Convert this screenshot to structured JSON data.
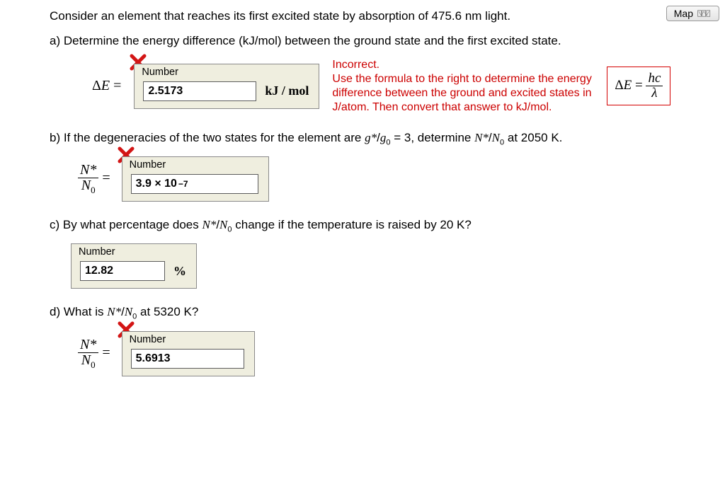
{
  "map_button": {
    "label": "Map"
  },
  "intro": "Consider an element that reaches its first excited state by absorption of 475.6 nm light.",
  "part_a": {
    "prompt": "a) Determine the energy difference (kJ/mol) between the ground state and the first excited state.",
    "prefix": "ΔE =",
    "number_label": "Number",
    "value": "2.5173",
    "unit": "kJ / mol",
    "feedback_line1": "Incorrect.",
    "feedback_rest": "Use the formula to the right to determine the energy difference between the ground and excited states in J/atom. Then convert that answer to kJ/mol.",
    "formula_text": "ΔE = hc / λ",
    "formula_lhs": "ΔE =",
    "formula_num": "hc",
    "formula_den": "λ"
  },
  "part_b": {
    "prompt_before": "b) If the degeneracies of the two states for the element are ",
    "ratio": "g*/g",
    "ratio_sub": "0",
    "ratio_eq": " = 3, determine ",
    "n_ratio_top": "N*",
    "n_ratio_bot_pre": "N",
    "n_ratio_bot_sub": "0",
    "prompt_after": " at 2050 K.",
    "prefix_num": "N*",
    "prefix_den_n": "N",
    "prefix_den_sub": "0",
    "number_label": "Number",
    "value_mant": "3.9 × 10",
    "value_exp": "−7"
  },
  "part_c": {
    "prompt_before": "c) By what percentage does ",
    "n_top": "N*",
    "n_bot_pre": "N",
    "n_bot_sub": "0",
    "prompt_after": " change if the temperature is raised by 20 K?",
    "number_label": "Number",
    "value": "12.82",
    "unit": "%"
  },
  "part_d": {
    "prompt_before": "d) What is ",
    "n_top": "N*",
    "n_bot_pre": "N",
    "n_bot_sub": "0",
    "prompt_after": " at 5320 K?",
    "prefix_num": "N*",
    "prefix_den_n": "N",
    "prefix_den_sub": "0",
    "number_label": "Number",
    "value": "5.6913"
  }
}
